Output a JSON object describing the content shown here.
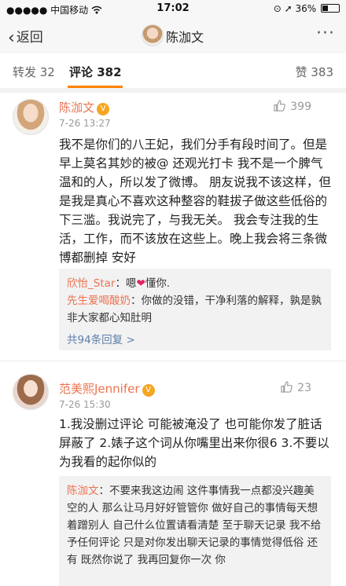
{
  "status_bar": {
    "carrier": "●●●●● 中国移动",
    "wifi_icon": "wifi-icon",
    "time": "17:02",
    "location_icon": "location-arrow-icon",
    "battery": "36%",
    "battery_level": 0.36
  },
  "nav": {
    "back_label": "返回",
    "title": "陈泇文",
    "more_label": "···"
  },
  "tabs": [
    {
      "label": "转发 32"
    },
    {
      "label": "评论 382"
    },
    {
      "label": "赞 383"
    }
  ],
  "comments": [
    {
      "name": "陈泇文",
      "time": "7-26 13:27",
      "likes": "399",
      "text": "我不是你们的八王妃，我们分手有段时间了。但是早上莫名其妙的被@ 还观光打卡 我不是一个脾气温和的人，所以发了微博。 朋友说我不该这样，但是我是真心不喜欢这种整容的鞋拔子做这些低俗的下三滥。我说完了，与我无关。 我会专注我的生活，工作，而不该放在这些上。晚上我会将三条微博都删掉 安好",
      "replies": [
        {
          "who": "欣怡_Star",
          "pre": "：嗯",
          "heart": "❤",
          "post": "懂你."
        },
        {
          "who": "先生爱喝酸奶",
          "text": "：你做的没错，干净利落的解释，孰是孰非大家都心知肚明"
        }
      ],
      "more_replies": "共94条回复 >"
    },
    {
      "name": "范美熙Jennifer",
      "time": "7-26 15:30",
      "likes": "23",
      "text": "1.我没删过评论 可能被淹没了 也可能你发了脏话屏蔽了 2.婊子这个词从你嘴里出来你很6 3.不要以为我看的起你似的",
      "replies": [
        {
          "who": "陈泇文",
          "text": "：不要来我这边闹 这件事情我一点都没兴趣美空的人 那么让马月好好管管你 做好自己的事情每天想着蹭别人 自己什么位置请看清楚 至于聊天记录 我不给予任何评论 只是对你发出聊天记录的事情觉得低俗 还有 既然你说了 我再回复你一次 你"
        }
      ]
    }
  ],
  "colors": {
    "accent": "#ff8200",
    "username": "#eb7350",
    "link": "#5d7ea8"
  }
}
